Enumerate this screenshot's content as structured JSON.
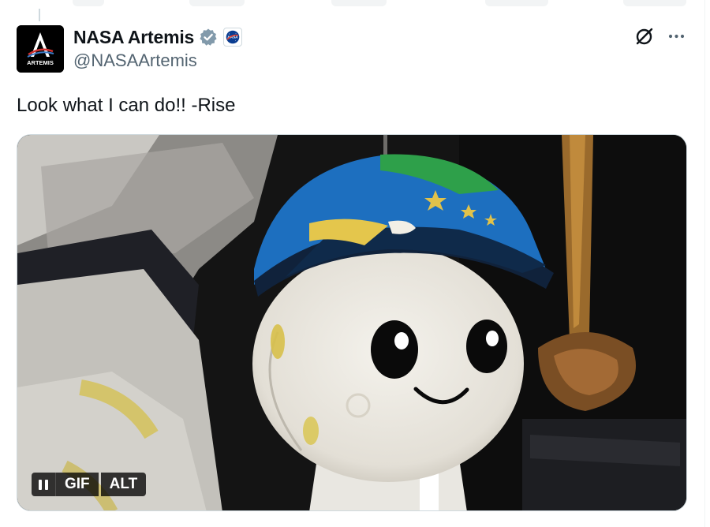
{
  "post": {
    "author": {
      "display_name": "NASA Artemis",
      "handle": "@NASAArtemis",
      "avatar_text": "ARTEMIS",
      "verified": true,
      "affiliate_badge_icon": "nasa-meatball-icon"
    },
    "text": "Look what I can do!! -Rise",
    "media": {
      "type": "gif",
      "controls": {
        "gif_label": "GIF",
        "alt_label": "ALT",
        "pause_icon": "pause-icon"
      }
    },
    "actions": {
      "grok_icon": "grok-icon",
      "more_icon": "more-icon"
    }
  },
  "colors": {
    "text_primary": "#0f1419",
    "text_secondary": "#536471",
    "verified_blue": "#829aab",
    "border": "#cfd9de"
  }
}
